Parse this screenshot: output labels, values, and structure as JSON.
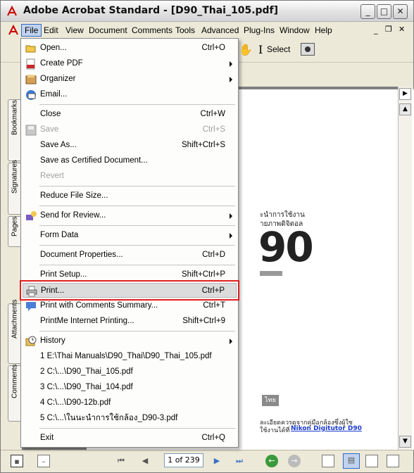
{
  "window": {
    "title": "Adobe Acrobat Standard - [D90_Thai_105.pdf]",
    "minimize": "_",
    "maximize": "□",
    "close": "✕"
  },
  "menubar": {
    "items": [
      "File",
      "Edit",
      "View",
      "Document",
      "Comments",
      "Tools",
      "Advanced",
      "Plug-Ins",
      "Window",
      "Help"
    ],
    "active": "File"
  },
  "toolbar": {
    "select_label": "Select"
  },
  "side_tabs": [
    "Bookmarks",
    "Signatures",
    "Pages",
    "Attachments",
    "Comments"
  ],
  "file_menu": {
    "items": [
      {
        "label": "Open...",
        "shortcut": "Ctrl+O",
        "icon": "open-folder-icon",
        "enabled": true
      },
      {
        "label": "Create PDF",
        "shortcut": "",
        "icon": "create-pdf-icon",
        "submenu": true,
        "enabled": true
      },
      {
        "label": "Organizer",
        "shortcut": "",
        "icon": "organizer-icon",
        "submenu": true,
        "enabled": true
      },
      {
        "label": "Email...",
        "shortcut": "",
        "icon": "email-icon",
        "enabled": true
      },
      {
        "label": "Close",
        "shortcut": "Ctrl+W",
        "enabled": true
      },
      {
        "label": "Save",
        "shortcut": "Ctrl+S",
        "icon": "save-disk-icon",
        "enabled": false
      },
      {
        "label": "Save As...",
        "shortcut": "Shift+Ctrl+S",
        "enabled": true
      },
      {
        "label": "Save as Certified Document...",
        "shortcut": "",
        "enabled": true
      },
      {
        "label": "Revert",
        "shortcut": "",
        "enabled": false
      },
      {
        "label": "Reduce File Size...",
        "shortcut": "",
        "enabled": true
      },
      {
        "label": "Send for Review...",
        "shortcut": "",
        "icon": "send-review-icon",
        "submenu": true,
        "enabled": true
      },
      {
        "label": "Form Data",
        "shortcut": "",
        "submenu": true,
        "enabled": true
      },
      {
        "label": "Document Properties...",
        "shortcut": "Ctrl+D",
        "enabled": true
      },
      {
        "label": "Print Setup...",
        "shortcut": "Shift+Ctrl+P",
        "enabled": true
      },
      {
        "label": "Print...",
        "shortcut": "Ctrl+P",
        "icon": "printer-icon",
        "enabled": true,
        "highlighted": true
      },
      {
        "label": "Print with Comments Summary...",
        "shortcut": "Ctrl+T",
        "icon": "comment-print-icon",
        "enabled": true
      },
      {
        "label": "PrintMe Internet Printing...",
        "shortcut": "Shift+Ctrl+9",
        "enabled": true
      },
      {
        "label": "History",
        "shortcut": "",
        "icon": "history-clock-icon",
        "submenu": true,
        "enabled": true
      },
      {
        "label": "1 E:\\Thai Manuals\\D90_Thai\\D90_Thai_105.pdf",
        "shortcut": "",
        "enabled": true
      },
      {
        "label": "2 C:\\...\\D90_Thai_105.pdf",
        "shortcut": "",
        "enabled": true
      },
      {
        "label": "3 C:\\...\\D90_Thai_104.pdf",
        "shortcut": "",
        "enabled": true
      },
      {
        "label": "4 C:\\...\\D90-12b.pdf",
        "shortcut": "",
        "enabled": true
      },
      {
        "label": "5 C:\\...\\ในนะนำการใช้กล้อง_D90-3.pdf",
        "shortcut": "",
        "enabled": true
      },
      {
        "label": "Exit",
        "shortcut": "Ctrl+Q",
        "enabled": true
      }
    ]
  },
  "document": {
    "thai_line1": "ะนำการใช้งาน",
    "thai_line2": "ายภาพดิจิตอล",
    "model": "90",
    "thai_badge": "ไทย",
    "footer_line1": "ละเอียดควรดูจากคู่มือกล้องซึ่งผู้ใช",
    "footer_line2": "ใช้งานได้ที่",
    "footer_link": "Nikon Digitutor D90"
  },
  "statusbar": {
    "page_indicator": "1 of 239"
  }
}
